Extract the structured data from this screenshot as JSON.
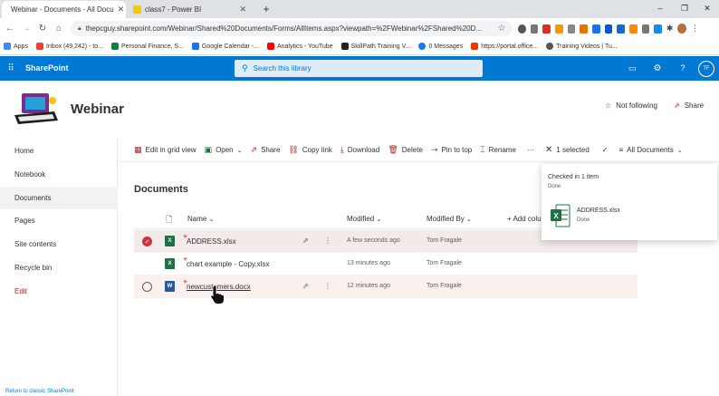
{
  "browser": {
    "tabs": [
      {
        "title": "Webinar - Documents - All Docu",
        "active": true
      },
      {
        "title": "class7 - Power BI",
        "active": false
      }
    ],
    "url": "thepcguy.sharepoint.com/Webinar/Shared%20Documents/Forms/AllItems.aspx?viewpath=%2FWebinar%2FShared%20D...",
    "bookmarks": [
      {
        "label": "Apps",
        "color": "#4285f4"
      },
      {
        "label": "Inbox (49,242) - to...",
        "color": "#ea4335"
      },
      {
        "label": "Personal Finance, S...",
        "color": "#0b8043"
      },
      {
        "label": "Google Calendar -...",
        "color": "#1a73e8"
      },
      {
        "label": "Analytics - YouTube",
        "color": "#ff0000"
      },
      {
        "label": "SkillPath Training V...",
        "color": "#222222"
      },
      {
        "label": "0 Messages",
        "color": "#1877f2"
      },
      {
        "label": "https://portal.office...",
        "color": "#eb3c00"
      },
      {
        "label": "Training Videos | Tu...",
        "color": "#555555"
      }
    ]
  },
  "suite": {
    "app_name": "SharePoint",
    "search_placeholder": "Search this library",
    "avatar_initials": "TF"
  },
  "site": {
    "title": "Webinar",
    "follow_label": "Not following",
    "share_label": "Share"
  },
  "nav": {
    "items": [
      "Home",
      "Notebook",
      "Documents",
      "Pages",
      "Site contents",
      "Recycle bin"
    ],
    "edit_label": "Edit",
    "classic_link": "Return to classic SharePoint"
  },
  "commands": {
    "edit_grid": "Edit in grid view",
    "open": "Open",
    "share": "Share",
    "copy_link": "Copy link",
    "download": "Download",
    "delete": "Delete",
    "pin": "Pin to top",
    "rename": "Rename",
    "more": "···",
    "selected": "1 selected",
    "view": "All Documents"
  },
  "library": {
    "title": "Documents",
    "columns": {
      "name": "Name",
      "modified": "Modified",
      "modified_by": "Modified By",
      "add_column": "+ Add colu"
    },
    "rows": [
      {
        "name": "ADDRESS.xlsx",
        "modified": "A few seconds ago",
        "modified_by": "Tom Fragale",
        "type": "xlsx",
        "selected": true
      },
      {
        "name": "chart example - Copy.xlsx",
        "modified": "13 minutes ago",
        "modified_by": "Tom Fragale",
        "type": "xlsx",
        "selected": false
      },
      {
        "name": "newcustomers.docx",
        "modified": "12 minutes ago",
        "modified_by": "Tom Fragale",
        "type": "docx",
        "selected": false
      }
    ]
  },
  "checkin_panel": {
    "title": "Checked in 1 item",
    "status": "Done",
    "file_name": "ADDRESS.xlsx",
    "file_status": "Done"
  },
  "colors": {
    "suite": "#0078d4",
    "accent": "#0078d4",
    "selected_check": "#d13438"
  }
}
